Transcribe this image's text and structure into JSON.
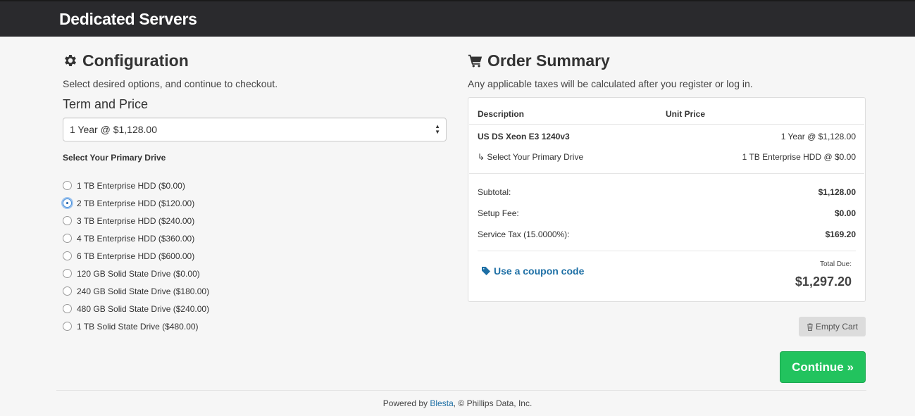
{
  "header": {
    "title": "Dedicated Servers"
  },
  "config": {
    "title": "Configuration",
    "subtitle": "Select desired options, and continue to checkout.",
    "term_label": "Term and Price",
    "term_selected": "1 Year @ $1,128.00",
    "drive_label": "Select Your Primary Drive",
    "drive_options": [
      {
        "label": "1 TB Enterprise HDD ($0.00)",
        "checked": false
      },
      {
        "label": "2 TB Enterprise HDD ($120.00)",
        "checked": true
      },
      {
        "label": "3 TB Enterprise HDD ($240.00)",
        "checked": false
      },
      {
        "label": "4 TB Enterprise HDD ($360.00)",
        "checked": false
      },
      {
        "label": "6 TB Enterprise HDD ($600.00)",
        "checked": false
      },
      {
        "label": "120 GB Solid State Drive ($0.00)",
        "checked": false
      },
      {
        "label": "240 GB Solid State Drive ($180.00)",
        "checked": false
      },
      {
        "label": "480 GB Solid State Drive ($240.00)",
        "checked": false
      },
      {
        "label": "1 TB Solid State Drive ($480.00)",
        "checked": false
      }
    ]
  },
  "summary": {
    "title": "Order Summary",
    "subtitle": "Any applicable taxes will be calculated after you register or log in.",
    "col_description": "Description",
    "col_unit_price": "Unit Price",
    "item_name": "US DS Xeon E3 1240v3",
    "item_price": "1 Year @ $1,128.00",
    "option_name": "Select Your Primary Drive",
    "option_value": "1 TB Enterprise HDD @ $0.00",
    "subtotal_label": "Subtotal:",
    "subtotal_value": "$1,128.00",
    "setup_label": "Setup Fee:",
    "setup_value": "$0.00",
    "tax_label": "Service Tax (15.0000%):",
    "tax_value": "$169.20",
    "coupon_link": "Use a coupon code",
    "total_label": "Total Due:",
    "total_value": "$1,297.20"
  },
  "buttons": {
    "empty_cart": "Empty Cart",
    "continue": "Continue »"
  },
  "footer": {
    "prefix": "Powered by ",
    "link": "Blesta",
    "suffix": ", © Phillips Data, Inc."
  },
  "colors": {
    "accent": "#22c35e",
    "link": "#1d6fa5",
    "topbar": "#2a2a2d"
  }
}
